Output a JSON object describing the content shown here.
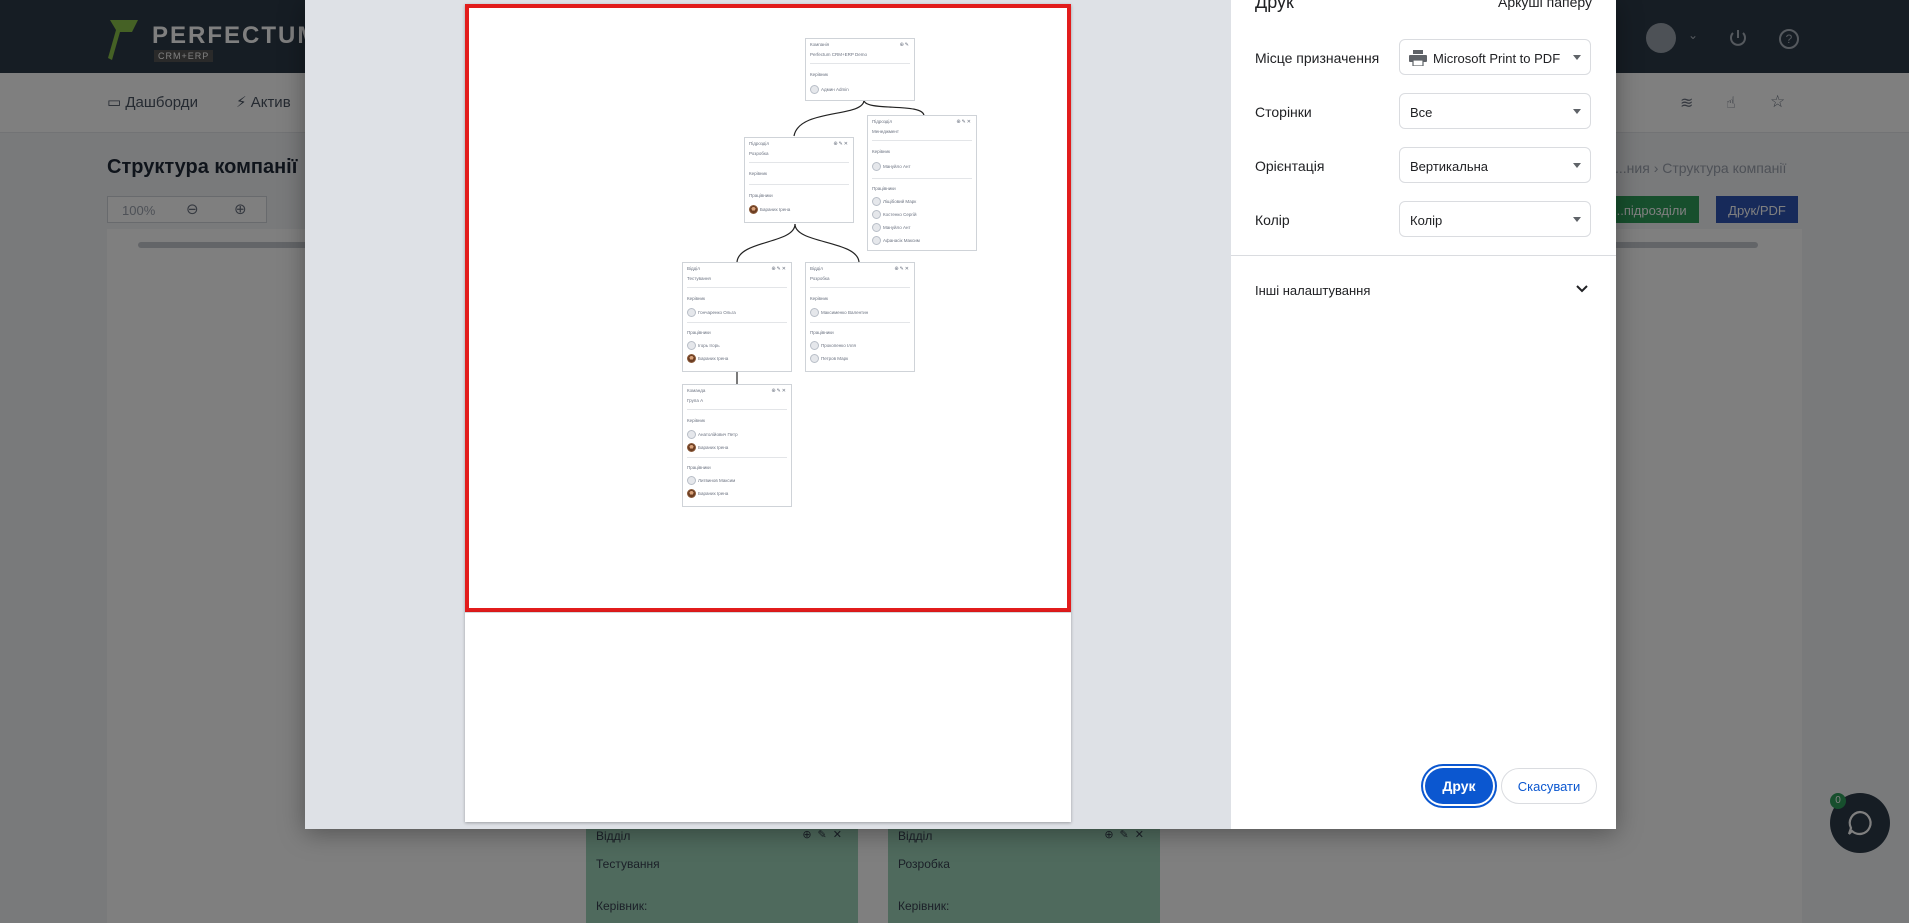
{
  "app": {
    "logo_text": "PERFECTUM",
    "logo_sub": "CRM+ERP",
    "nav": {
      "dashboards": "Дашборди",
      "activity": "Актив"
    },
    "page_title": "Структура компанії",
    "zoom": "100%",
    "breadcrumb": {
      "parent": "...ния",
      "current": "Структура компанії"
    },
    "buttons": {
      "departments": "...підрозділи",
      "print_pdf": "Друк/PDF"
    },
    "chat_badge": "0",
    "bottom_cards": [
      {
        "type": "Відділ",
        "name": "Тестування",
        "head_label": "Керівник:"
      },
      {
        "type": "Відділ",
        "name": "Розробка",
        "head_label": "Керівник:"
      }
    ],
    "colors": {
      "topbar": "#2d3a48",
      "green_button": "#2e9e5b",
      "blue_button": "#2f55b5",
      "card_green": "#9fd4ba"
    }
  },
  "print_dialog": {
    "title": "Друк",
    "sheets": "Аркуші паперу",
    "destination": {
      "label": "Місце призначення",
      "value": "Microsoft Print to PDF"
    },
    "pages": {
      "label": "Сторінки",
      "value": "Все"
    },
    "orientation": {
      "label": "Орієнтація",
      "value": "Вертикальна"
    },
    "color": {
      "label": "Колір",
      "value": "Колір"
    },
    "more_settings": "Інші налаштування",
    "print_button": "Друк",
    "cancel_button": "Скасувати"
  },
  "preview_tree": [
    {
      "type": "Компанія",
      "name": "Perfectum CRM+ERP Demo",
      "head_label": "Керівник",
      "heads": [
        "Админ Admin"
      ],
      "staff_label": "",
      "staff": []
    },
    {
      "type": "Підрозділ",
      "name": "Менеджмент",
      "head_label": "Керівник",
      "heads": [
        "Мануйло Ант"
      ],
      "staff_label": "Працівники",
      "staff": [
        "Ліщібовий Марк",
        "Костенко Сергій",
        "Мануйло Ант",
        "Афанасік Максим"
      ]
    },
    {
      "type": "Підрозділ",
      "name": "Розробка",
      "head_label": "Керівник",
      "heads": [],
      "staff_label": "Працівники",
      "staff": [
        "Бараних Ірена"
      ]
    },
    {
      "type": "Відділ",
      "name": "Тестування",
      "head_label": "Керівник",
      "heads": [
        "Гончаренко Ольга"
      ],
      "staff_label": "Працівники",
      "staff": [
        "Ігорь Ігорь",
        "Бараних Ірена"
      ]
    },
    {
      "type": "Відділ",
      "name": "Розробка",
      "head_label": "Керівник",
      "heads": [
        "Максименко Валентин"
      ],
      "staff_label": "Працівники",
      "staff": [
        "Прокопенко Ілля",
        "Петров Марк"
      ]
    },
    {
      "type": "Команда",
      "name": "Група А",
      "head_label": "Керівник",
      "heads": [
        "Анатолійович Петр",
        "Бараних Ірена"
      ],
      "staff_label": "Працівники",
      "staff": [
        "Литвинов Максим",
        "Бараних Ірена"
      ]
    }
  ]
}
